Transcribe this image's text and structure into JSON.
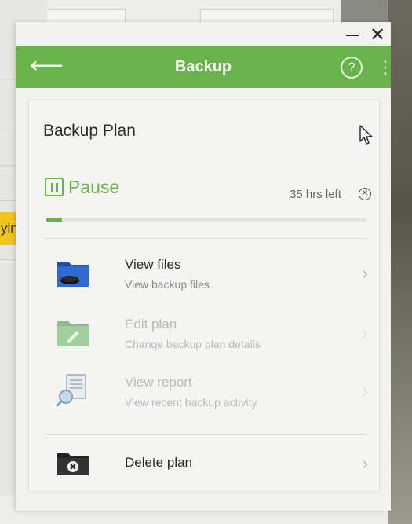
{
  "background": {
    "side_tag_text": "ying"
  },
  "window": {
    "controls": {
      "minimize_icon": "minimize-icon",
      "close_icon": "close-icon",
      "close_glyph": "✕"
    }
  },
  "appbar": {
    "title": "Backup",
    "back_glyph": "⟵",
    "help_glyph": "?",
    "more_glyph": "⋮",
    "color": "#6ab34a"
  },
  "plan": {
    "title": "Backup Plan",
    "pause_label": "Pause",
    "time_left": "35 hrs left",
    "cancel_glyph": "✕",
    "progress": 0.05,
    "accent": "#6ab34a"
  },
  "menu": [
    {
      "title": "View files",
      "subtitle": "View backup files",
      "icon": "folder-icon",
      "enabled": true
    },
    {
      "title": "Edit plan",
      "subtitle": "Change backup plan details",
      "icon": "edit-folder-icon",
      "enabled": false
    },
    {
      "title": "View report",
      "subtitle": "View recent backup activity",
      "icon": "report-icon",
      "enabled": false
    },
    {
      "title": "Delete plan",
      "subtitle": "",
      "icon": "delete-folder-icon",
      "enabled": true
    }
  ],
  "chevron_glyph": "›"
}
